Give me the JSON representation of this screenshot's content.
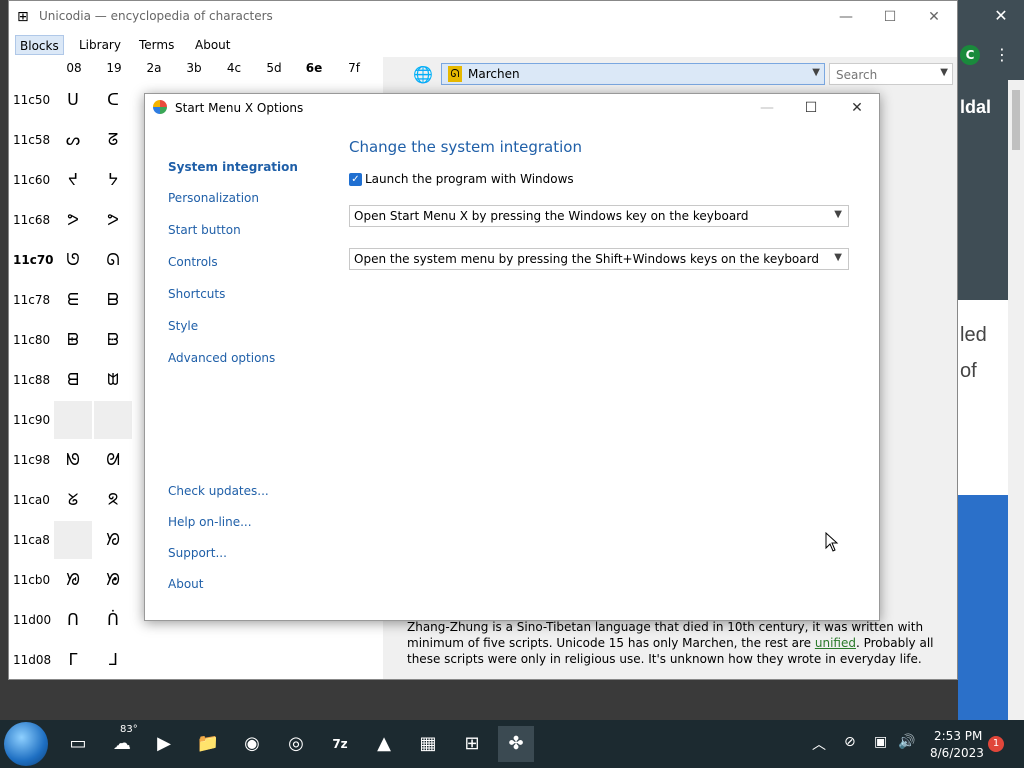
{
  "background": {
    "partial_texts": [
      "ldal",
      "led",
      "of"
    ],
    "avatar_letter": "C",
    "close_glyph": "✕",
    "more_glyph": "⋮"
  },
  "unicodia": {
    "title": "Unicodia — encyclopedia of characters",
    "menu": [
      "Blocks",
      "Library",
      "Terms",
      "About"
    ],
    "columns": [
      "08",
      "19",
      "2a",
      "3b",
      "4c",
      "5d",
      "6e",
      "7f"
    ],
    "rows": [
      "11c50",
      "11c58",
      "11c60",
      "11c68",
      "11c70",
      "11c78",
      "11c80",
      "11c88",
      "11c90",
      "11c98",
      "11ca0",
      "11ca8",
      "11cb0",
      "11d00",
      "11d08"
    ],
    "cells": [
      [
        "ᑌ",
        "ᑕ"
      ],
      [
        "ᔕ",
        "ᘔ"
      ],
      [
        "ᔪ",
        "ᔭ"
      ],
      [
        "ᕗ",
        "ᕗ"
      ],
      [
        "ᘎ",
        "ᘏ"
      ],
      [
        "ᗴ",
        "ᗷ"
      ],
      [
        "ᗸ",
        "ᗹ"
      ],
      [
        "ᗺ",
        "ᗻ"
      ],
      [
        "",
        ""
      ],
      [
        "ᘚ",
        "ᘛ"
      ],
      [
        "ᘜ",
        "ᘝ"
      ],
      [
        "",
        "ᘞ"
      ],
      [
        "ᘟ",
        "ᘠ"
      ],
      [
        "ᑎ",
        "ᑏ"
      ],
      [
        "ᒥ",
        "ᒧ"
      ]
    ],
    "script_name": "Marchen",
    "search_placeholder": "Search",
    "description_part1": "Zhang-Zhung is a Sino-Tibetan language that died in 10th century, it was written with minimum of five scripts. Unicode 15 has only Marchen, the rest are ",
    "description_link": "unified",
    "description_part2": ". Probably all these scripts were only in religious use. It's unknown how they wrote in everyday life."
  },
  "dialog": {
    "title": "Start Menu X Options",
    "nav": [
      "System integration",
      "Personalization",
      "Start button",
      "Controls",
      "Shortcuts",
      "Style",
      "Advanced options"
    ],
    "links": [
      "Check updates...",
      "Help on-line...",
      "Support...",
      "About"
    ],
    "heading": "Change the system integration",
    "checkbox_label": "Launch the program with Windows",
    "checkbox_checked": true,
    "select1": "Open Start Menu X by pressing the Windows key on the keyboard",
    "select2": "Open the system menu by pressing the Shift+Windows keys on the keyboard",
    "accent_color": "#1f5fa8"
  },
  "taskbar": {
    "weather_temp": "83°",
    "time": "2:53 PM",
    "date": "8/6/2023",
    "notification_count": "1",
    "apps": [
      "task-view",
      "weather",
      "meet",
      "file-explorer",
      "firefox",
      "chrome",
      "7zip",
      "inkscape",
      "winrar",
      "unicodia",
      "start-menu-x"
    ]
  }
}
